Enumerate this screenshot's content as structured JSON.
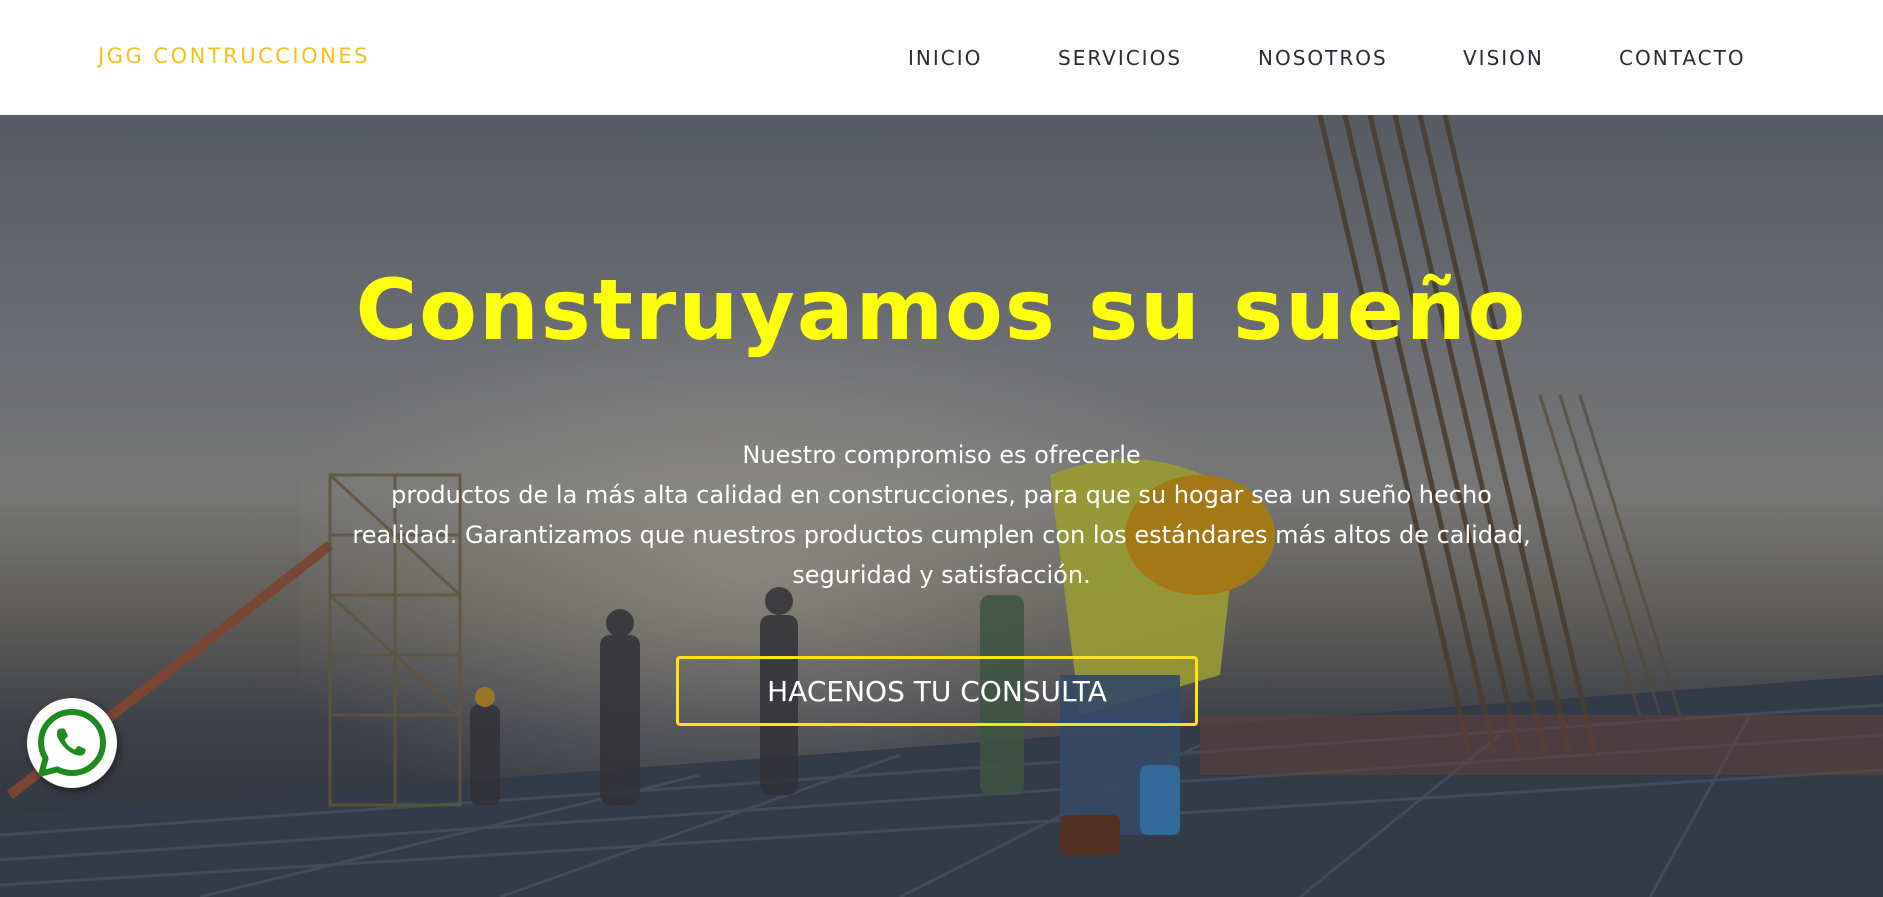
{
  "brand": {
    "name": "JGG CONTRUCCIONES"
  },
  "nav": {
    "items": [
      {
        "label": "INICIO"
      },
      {
        "label": "SERVICIOS"
      },
      {
        "label": "NOSOTROS"
      },
      {
        "label": "VISION"
      },
      {
        "label": "CONTACTO"
      }
    ]
  },
  "hero": {
    "title": "Construyamos su sueño",
    "lines": [
      "Nuestro compromiso es ofrecerle",
      "productos de la más alta calidad en construcciones, para que su hogar sea un sueño hecho",
      "realidad. Garantizamos que nuestros productos cumplen con los estándares más altos de calidad,",
      "seguridad y satisfacción."
    ],
    "cta_label": "HACENOS TU CONSULTA"
  },
  "floating": {
    "icon": "whatsapp-icon"
  },
  "colors": {
    "brand": "#f2c21b",
    "title": "#ffff0a",
    "nav_text": "#2b2b33",
    "cta_border": "#ffe21a",
    "whatsapp": "#1f8a1f"
  }
}
